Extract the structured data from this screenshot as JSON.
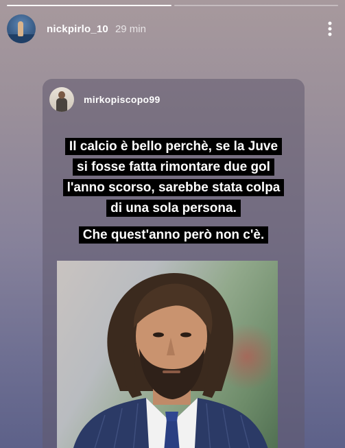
{
  "story": {
    "progress": [
      1.0,
      0.0
    ],
    "owner_username": "nickpirlo_10",
    "timestamp": "29 min",
    "owner_avatar_icon": "profile-photo",
    "more_icon": "vertical-ellipsis-icon"
  },
  "shared_post": {
    "author_username": "mirkopiscopo99",
    "caption_lines": [
      "Il calcio è bello perchè, se la Juve",
      "si fosse fatta rimontare due gol",
      "l'anno scorso, sarebbe stata colpa",
      "di una sola persona."
    ],
    "caption_sub": "Che quest'anno però non c'è.",
    "photo_description_icon": "man-portrait-photo"
  },
  "colors": {
    "background_top": "#a7999d",
    "background_bottom": "#5d6189",
    "caption_bg": "#000000",
    "text": "#ffffff"
  }
}
